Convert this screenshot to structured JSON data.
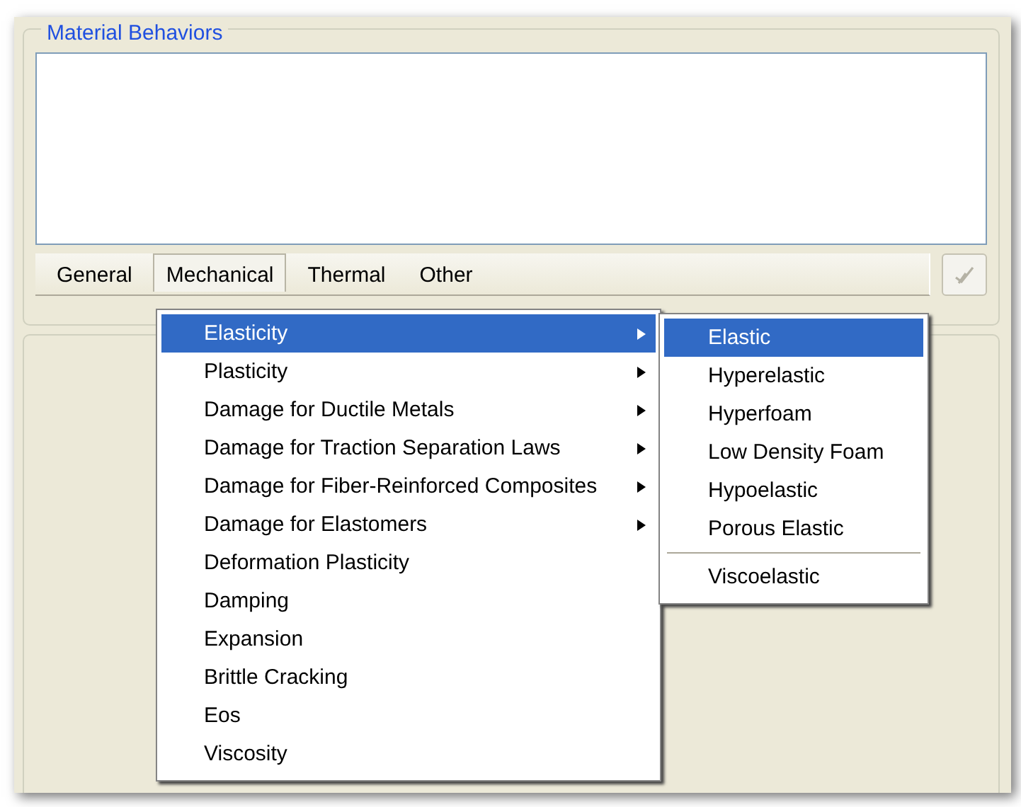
{
  "group": {
    "title": "Material Behaviors"
  },
  "tabs": [
    {
      "label": "General",
      "selected": false
    },
    {
      "label": "Mechanical",
      "selected": true
    },
    {
      "label": "Thermal",
      "selected": false
    },
    {
      "label": "Other",
      "selected": false
    }
  ],
  "edit_button": {
    "disabled": true
  },
  "menu": {
    "items": [
      {
        "label": "Elasticity",
        "has_submenu": true,
        "selected": true
      },
      {
        "label": "Plasticity",
        "has_submenu": true,
        "selected": false
      },
      {
        "label": "Damage for Ductile Metals",
        "has_submenu": true,
        "selected": false
      },
      {
        "label": "Damage for Traction Separation Laws",
        "has_submenu": true,
        "selected": false
      },
      {
        "label": "Damage for Fiber-Reinforced Composites",
        "has_submenu": true,
        "selected": false
      },
      {
        "label": "Damage for Elastomers",
        "has_submenu": true,
        "selected": false
      },
      {
        "label": "Deformation Plasticity",
        "has_submenu": false,
        "selected": false
      },
      {
        "label": "Damping",
        "has_submenu": false,
        "selected": false
      },
      {
        "label": "Expansion",
        "has_submenu": false,
        "selected": false
      },
      {
        "label": "Brittle Cracking",
        "has_submenu": false,
        "selected": false
      },
      {
        "label": "Eos",
        "has_submenu": false,
        "selected": false
      },
      {
        "label": "Viscosity",
        "has_submenu": false,
        "selected": false
      }
    ]
  },
  "submenu": {
    "items": [
      {
        "kind": "item",
        "label": "Elastic",
        "selected": true
      },
      {
        "kind": "item",
        "label": "Hyperelastic",
        "selected": false
      },
      {
        "kind": "item",
        "label": "Hyperfoam",
        "selected": false
      },
      {
        "kind": "item",
        "label": "Low Density Foam",
        "selected": false
      },
      {
        "kind": "item",
        "label": "Hypoelastic",
        "selected": false
      },
      {
        "kind": "item",
        "label": "Porous Elastic",
        "selected": false
      },
      {
        "kind": "separator"
      },
      {
        "kind": "item",
        "label": "Viscoelastic",
        "selected": false
      }
    ]
  }
}
